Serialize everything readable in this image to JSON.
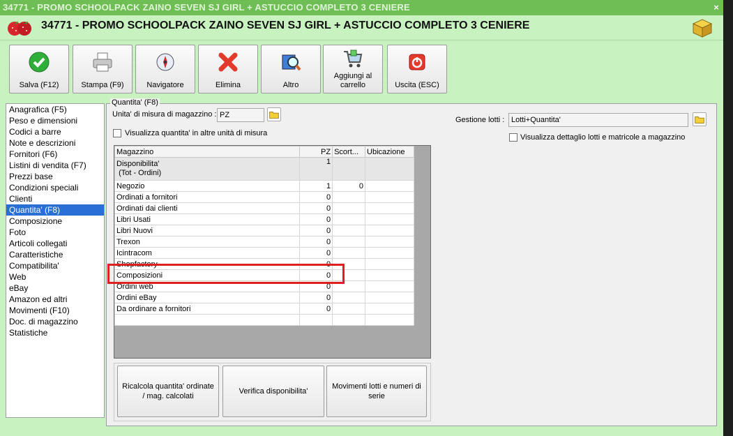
{
  "window": {
    "title": "34771 - PROMO SCHOOLPACK ZAINO SEVEN SJ GIRL + ASTUCCIO COMPLETO 3 CENIERE",
    "close": "×",
    "header_title": "34771 - PROMO SCHOOLPACK ZAINO SEVEN SJ GIRL + ASTUCCIO COMPLETO 3 CENIERE"
  },
  "toolbar": [
    {
      "label": "Salva (F12)",
      "icon": "check-icon"
    },
    {
      "label": "Stampa (F9)",
      "icon": "printer-icon"
    },
    {
      "label": "Navigatore",
      "icon": "compass-icon"
    },
    {
      "label": "Elimina",
      "icon": "delete-x-icon"
    },
    {
      "label": "Altro",
      "icon": "search-book-icon"
    },
    {
      "label": "Aggiungi al carrello",
      "icon": "cart-icon"
    },
    {
      "label": "Uscita (ESC)",
      "icon": "exit-icon"
    }
  ],
  "sidebar": {
    "items": [
      "Anagrafica (F5)",
      "Peso e dimensioni",
      "Codici a barre",
      "Note e descrizioni",
      "Fornitori (F6)",
      "Listini di vendita (F7)",
      "Prezzi base",
      "Condizioni speciali",
      "Clienti",
      "Quantita' (F8)",
      "Composizione",
      "Foto",
      "Articoli collegati",
      "Caratteristiche",
      "Compatibilita'",
      "Web",
      "eBay",
      "Amazon ed altri",
      "Movimenti (F10)",
      "Doc. di magazzino",
      "Statistiche"
    ],
    "selected_index": 9
  },
  "quantita": {
    "group_caption": "Quantita' (F8)",
    "unit_label": "Unita' di misura di magazzino :",
    "unit_value": "PZ",
    "show_other_units": "Visualizza quantita' in altre unità di misura",
    "lotti_label": "Gestione lotti :",
    "lotti_value": "Lotti+Quantita'",
    "show_lot_detail": "Visualizza dettaglio lotti e matricole a magazzino"
  },
  "grid": {
    "headers": [
      "Magazzino",
      "PZ",
      "Scort...",
      "Ubicazione"
    ],
    "rows": [
      {
        "name": "Disponibilita'",
        "sub": "(Tot - Ordini)",
        "pz": "1",
        "scorta": "",
        "ubic": ""
      },
      {
        "name": "Negozio",
        "pz": "1",
        "scorta": "0",
        "ubic": ""
      },
      {
        "name": "Ordinati a fornitori",
        "pz": "0",
        "scorta": "",
        "ubic": ""
      },
      {
        "name": "Ordinati dai clienti",
        "pz": "0",
        "scorta": "",
        "ubic": ""
      },
      {
        "name": "Libri Usati",
        "pz": "0",
        "scorta": "",
        "ubic": ""
      },
      {
        "name": "Libri Nuovi",
        "pz": "0",
        "scorta": "",
        "ubic": ""
      },
      {
        "name": "Trexon",
        "pz": "0",
        "scorta": "",
        "ubic": ""
      },
      {
        "name": "Icintracom",
        "pz": "0",
        "scorta": "",
        "ubic": ""
      },
      {
        "name": "Shopfactory",
        "pz": "0",
        "scorta": "",
        "ubic": ""
      },
      {
        "name": "Composizioni",
        "pz": "0",
        "scorta": "",
        "ubic": ""
      },
      {
        "name": "Ordini web",
        "pz": "0",
        "scorta": "",
        "ubic": ""
      },
      {
        "name": "Ordini eBay",
        "pz": "0",
        "scorta": "",
        "ubic": ""
      },
      {
        "name": "Da ordinare a fornitori",
        "pz": "0",
        "scorta": "",
        "ubic": ""
      }
    ]
  },
  "actions": {
    "recalc": "Ricalcola quantita' ordinate / mag. calcolati",
    "verify": "Verifica disponibilita'",
    "movements": "Movimenti lotti e numeri di serie"
  },
  "colors": {
    "accent": "#2a6fd6",
    "window_bg": "#c8f3c0",
    "titlebar": "#6fbd55",
    "highlight": "#e02020"
  }
}
